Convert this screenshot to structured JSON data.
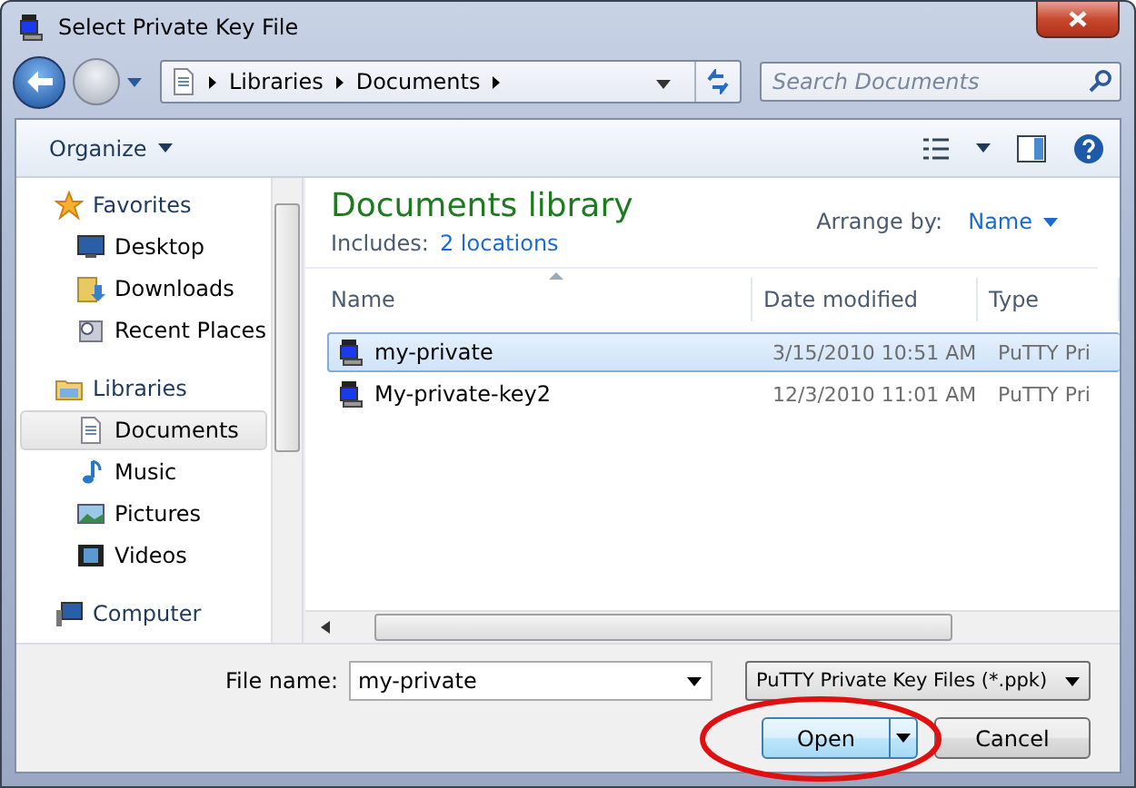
{
  "window": {
    "title": "Select Private Key File"
  },
  "address": {
    "crumbs": [
      "Libraries",
      "Documents"
    ]
  },
  "search": {
    "placeholder": "Search Documents"
  },
  "toolbar": {
    "organize": "Organize"
  },
  "nav": [
    {
      "label": "Favorites",
      "kind": "star",
      "selected": false,
      "children": [
        {
          "label": "Desktop",
          "kind": "desktop",
          "selected": false
        },
        {
          "label": "Downloads",
          "kind": "downloads",
          "selected": false
        },
        {
          "label": "Recent Places",
          "kind": "recent",
          "selected": false
        }
      ]
    },
    {
      "label": "Libraries",
      "kind": "library",
      "selected": false,
      "children": [
        {
          "label": "Documents",
          "kind": "document",
          "selected": true
        },
        {
          "label": "Music",
          "kind": "music",
          "selected": false
        },
        {
          "label": "Pictures",
          "kind": "pictures",
          "selected": false
        },
        {
          "label": "Videos",
          "kind": "videos",
          "selected": false
        }
      ]
    },
    {
      "label": "Computer",
      "kind": "computer",
      "selected": false
    }
  ],
  "library": {
    "title": "Documents library",
    "includes_label": "Includes:",
    "includes_link": "2 locations",
    "arrange_label": "Arrange by:",
    "arrange_value": "Name"
  },
  "table": {
    "columns": [
      "Name",
      "Date modified",
      "Type"
    ],
    "rows": [
      {
        "name": "my-private",
        "date": "3/15/2010 10:51 AM",
        "type": "PuTTY Pri",
        "selected": true
      },
      {
        "name": "My-private-key2",
        "date": "12/3/2010 11:01 AM",
        "type": "PuTTY Pri",
        "selected": false
      }
    ]
  },
  "file_name": {
    "label": "File name:",
    "value": "my-private"
  },
  "file_type": {
    "value": "PuTTY Private Key Files (*.ppk)"
  },
  "buttons": [
    {
      "label": "Open",
      "kind": "split"
    },
    {
      "label": "Cancel",
      "kind": "plain"
    }
  ]
}
